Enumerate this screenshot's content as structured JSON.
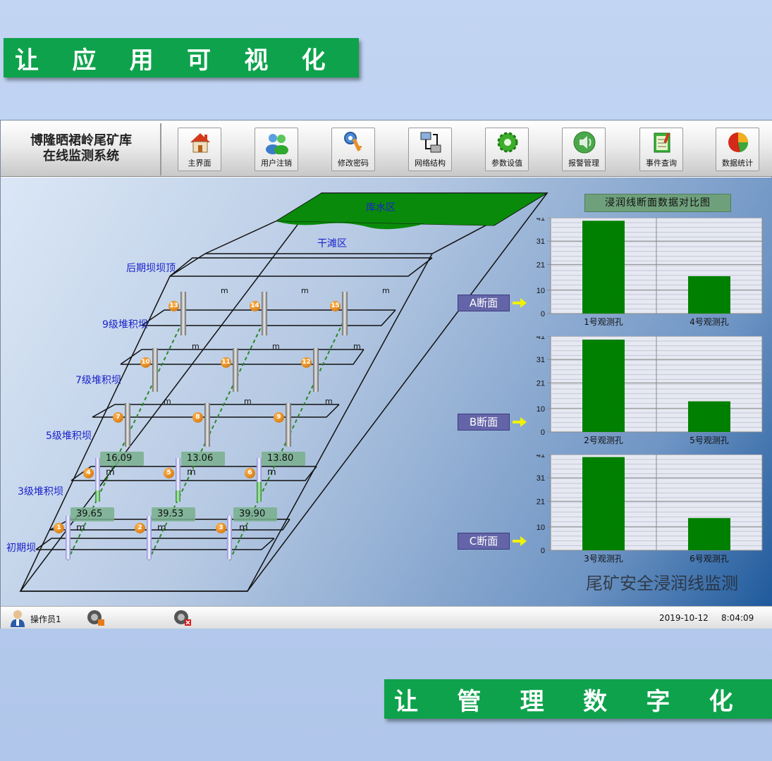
{
  "banners": {
    "top": [
      "让",
      "应",
      "用",
      "可",
      "视",
      "化"
    ],
    "bottom": [
      "让",
      "管",
      "理",
      "数",
      "字",
      "化"
    ]
  },
  "app": {
    "title_line1": "博隆晒裙岭尾矿库",
    "title_line2": "在线监测系统"
  },
  "toolbar": {
    "buttons": [
      {
        "label": "主界面",
        "icon": "home-icon"
      },
      {
        "label": "用户注销",
        "icon": "users-icon"
      },
      {
        "label": "修改密码",
        "icon": "key-icon"
      },
      {
        "label": "网络结构",
        "icon": "network-icon"
      },
      {
        "label": "参数设值",
        "icon": "gear-icon"
      },
      {
        "label": "报警管理",
        "icon": "speaker-alarm-icon"
      },
      {
        "label": "事件查询",
        "icon": "notepad-icon"
      },
      {
        "label": "数据统计",
        "icon": "pie-chart-icon"
      }
    ]
  },
  "diagram": {
    "reservoir_label": "库水区",
    "beach_label": "干滩区",
    "levels": [
      "后期坝坝顶",
      "9级堆积坝",
      "7级堆积坝",
      "5级堆积坝",
      "3级堆积坝",
      "初期坝"
    ],
    "unit": "m",
    "markers": [
      "1",
      "2",
      "3",
      "4",
      "5",
      "6",
      "7",
      "8",
      "9",
      "10",
      "11",
      "12",
      "13",
      "14",
      "15"
    ],
    "readings_row1": [
      "16.09",
      "13.06",
      "13.80"
    ],
    "readings_row2": [
      "39.65",
      "39.53",
      "39.90"
    ]
  },
  "sections": {
    "title": "浸润线断面数据对比图",
    "labels": [
      "A断面",
      "B断面",
      "C断面"
    ],
    "footer_label": "尾矿安全浸润线监测"
  },
  "chart_data": [
    {
      "type": "bar",
      "title": "",
      "categories": [
        "1号观测孔",
        "4号观测孔"
      ],
      "values": [
        39.7,
        16.0
      ],
      "ylim": [
        0,
        41
      ],
      "yticks": [
        0,
        10,
        21,
        31,
        41
      ],
      "color": "#008000",
      "grid": true
    },
    {
      "type": "bar",
      "title": "",
      "categories": [
        "2号观测孔",
        "5号观测孔"
      ],
      "values": [
        39.5,
        13.1
      ],
      "ylim": [
        0,
        41
      ],
      "yticks": [
        0,
        10,
        21,
        31,
        41
      ],
      "color": "#008000",
      "grid": true
    },
    {
      "type": "bar",
      "title": "",
      "categories": [
        "3号观测孔",
        "6号观测孔"
      ],
      "values": [
        39.9,
        13.8
      ],
      "ylim": [
        0,
        41
      ],
      "yticks": [
        0,
        10,
        21,
        31,
        41
      ],
      "color": "#008000",
      "grid": true
    }
  ],
  "status": {
    "operator": "操作员1",
    "date": "2019-10-12",
    "time": "8:04:09"
  },
  "colors": {
    "banner": "#0fa24c",
    "bar": "#008000",
    "level_text": "#1a22cc",
    "section_button": "#6464a8"
  }
}
